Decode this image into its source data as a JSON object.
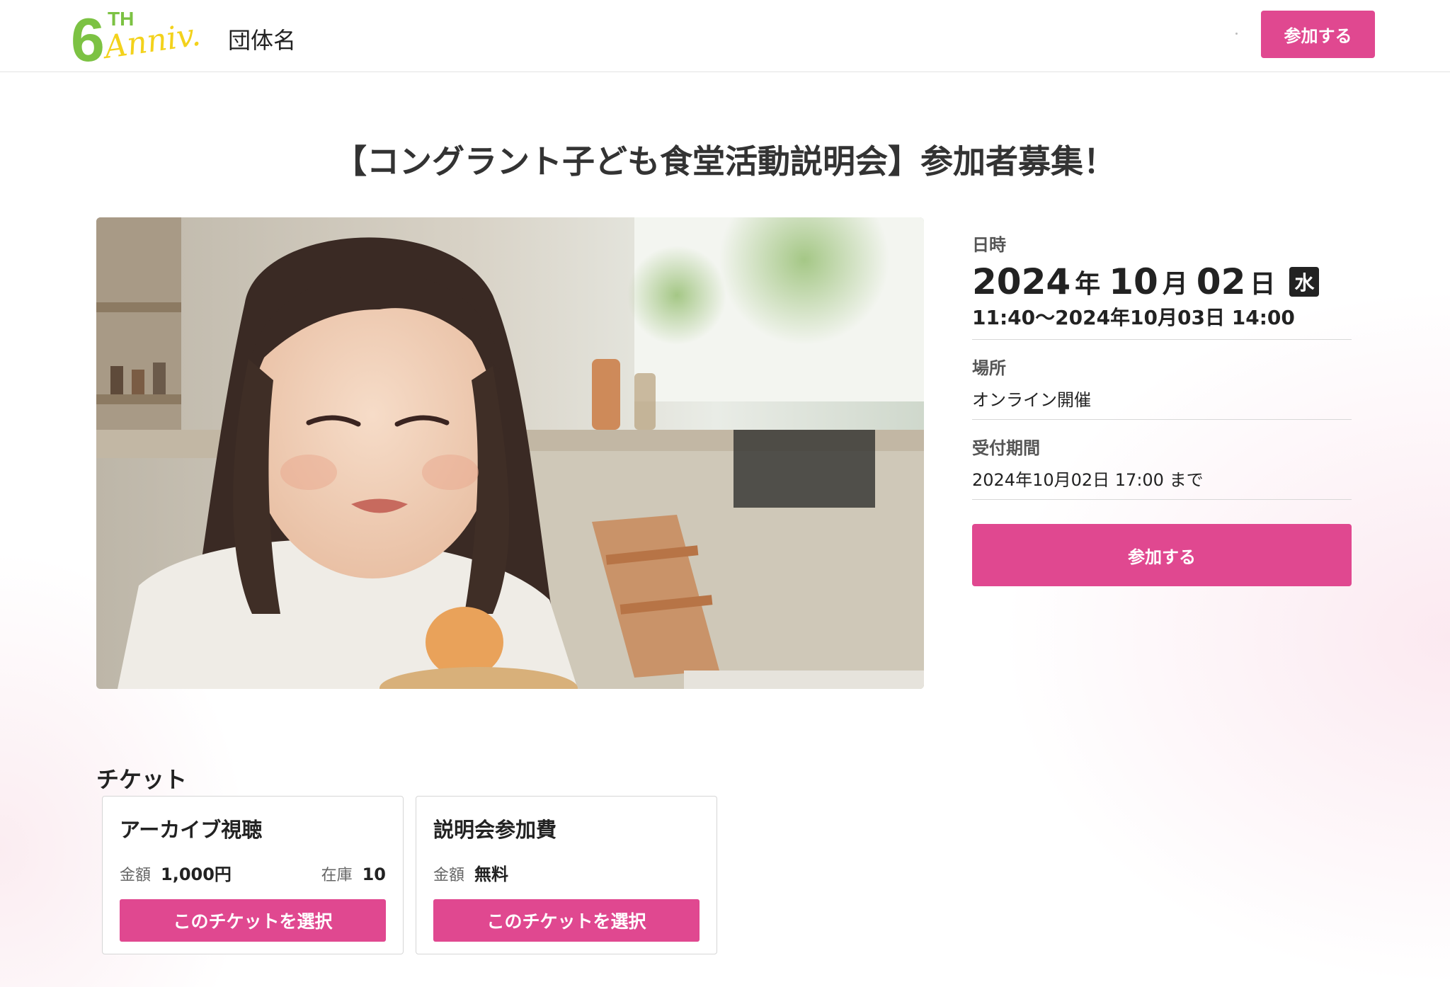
{
  "header": {
    "logo": {
      "number": "6",
      "superscript": "TH",
      "script": "Anniv."
    },
    "org_name": "団体名",
    "join_label": "参加する"
  },
  "event": {
    "title": "【コングラント子ども食堂活動説明会】参加者募集！",
    "image_alt": "photo-of-girl-eating"
  },
  "details": {
    "datetime_label": "日時",
    "year": "2024",
    "year_unit": "年",
    "month": "10",
    "month_unit": "月",
    "day": "02",
    "day_unit": "日",
    "weekday": "水",
    "time_range": "11:40〜2024年10月03日 14:00",
    "place_label": "場所",
    "place_value": "オンライン開催",
    "reception_label": "受付期間",
    "reception_value": "2024年10月02日 17:00 まで",
    "join_label": "参加する"
  },
  "tickets": {
    "heading": "チケット",
    "items": [
      {
        "name": "アーカイブ視聴",
        "price_label": "金額",
        "price": "1,000円",
        "stock_label": "在庫",
        "stock": "10",
        "select_label": "このチケットを選択"
      },
      {
        "name": "説明会参加費",
        "price_label": "金額",
        "price": "無料",
        "select_label": "このチケットを選択"
      }
    ]
  },
  "colors": {
    "accent": "#e04890",
    "logo_green": "#7cc243",
    "logo_yellow": "#f3d21c"
  }
}
